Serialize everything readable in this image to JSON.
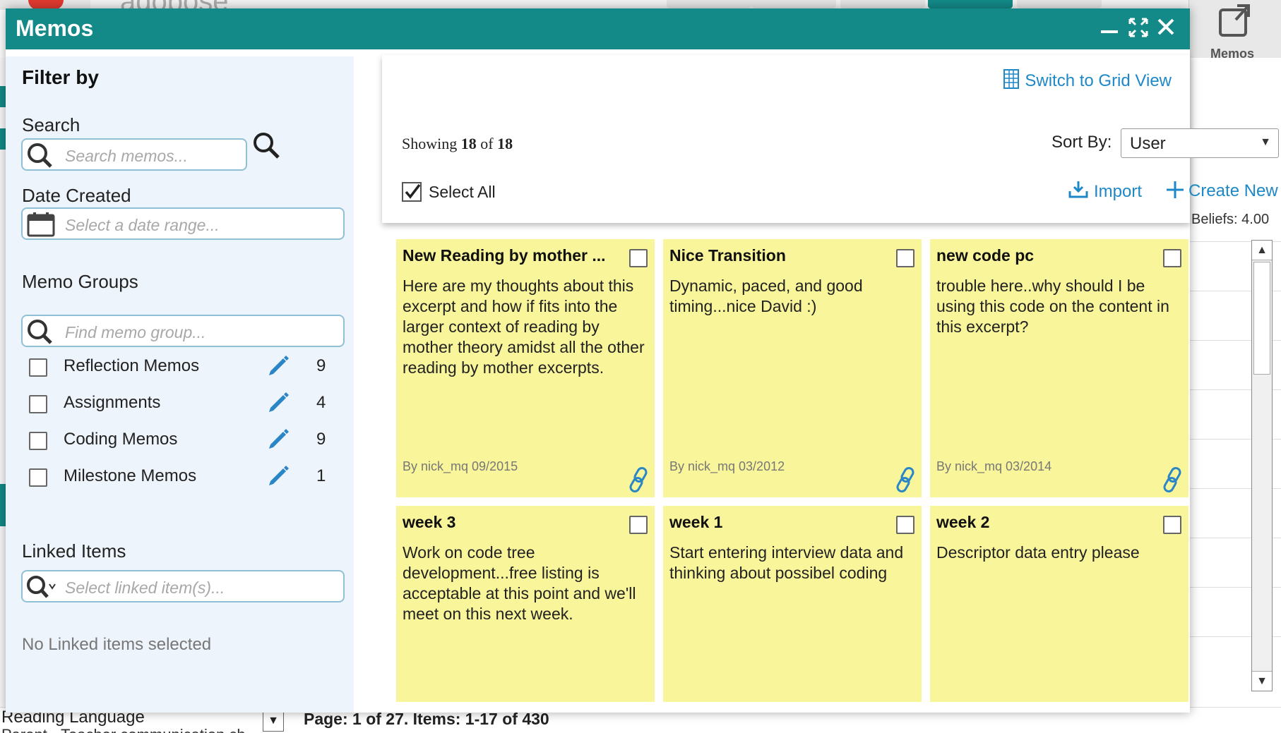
{
  "background": {
    "logo_text": "adobose",
    "memos_button_label": "Memos",
    "beliefs_text": "Beliefs: 4.00",
    "reading_language": "Reading Language",
    "parent_text": "Parent - Teacher communication ch",
    "pager_text": "Page: 1 of 27. Items: 1-17 of 430"
  },
  "modal": {
    "title": "Memos",
    "accent_color": "#138a87"
  },
  "filter": {
    "title": "Filter by",
    "search_label": "Search",
    "search_placeholder": "Search memos...",
    "date_label": "Date Created",
    "date_placeholder": "Select a date range...",
    "groups_label": "Memo Groups",
    "groups_placeholder": "Find memo group...",
    "groups": [
      {
        "name": "Reflection Memos",
        "count": "9"
      },
      {
        "name": "Assignments",
        "count": "4"
      },
      {
        "name": "Coding Memos",
        "count": "9"
      },
      {
        "name": "Milestone Memos",
        "count": "1"
      }
    ],
    "linked_label": "Linked Items",
    "linked_placeholder": "Select linked item(s)...",
    "no_linked": "No Linked items selected"
  },
  "toolbar": {
    "grid_view_label": "Switch to Grid View",
    "showing_prefix": "Showing",
    "showing_count": "18",
    "showing_of": "of",
    "showing_total": "18",
    "sort_label": "Sort By:",
    "sort_value": "User",
    "select_all_label": "Select All",
    "import_label": "Import",
    "create_label": "Create New",
    "link_color": "#1e88c7"
  },
  "memos": [
    {
      "title": "New Reading by mother ...",
      "body": "Here are my thoughts about this excerpt and how if fits into the larger context of reading by mother theory amidst all the other reading by mother excerpts.",
      "meta": "By nick_mq 09/2015",
      "linked": true
    },
    {
      "title": "Nice Transition",
      "body": "Dynamic, paced, and good timing...nice David :)",
      "meta": "By nick_mq 03/2012",
      "linked": true
    },
    {
      "title": "new code pc",
      "body": "trouble here..why should I be using this code on the content in this excerpt?",
      "meta": "By nick_mq 03/2014",
      "linked": true
    },
    {
      "title": "week 3",
      "body": "Work on code tree development...free listing is acceptable at this point and we'll meet on this next week.",
      "meta": "",
      "linked": false
    },
    {
      "title": "week 1",
      "body": "Start entering interview data and thinking about possibel coding",
      "meta": "",
      "linked": false
    },
    {
      "title": "week 2",
      "body": "Descriptor data entry please",
      "meta": "",
      "linked": false
    }
  ],
  "memo_card_color": "#f9f59a"
}
